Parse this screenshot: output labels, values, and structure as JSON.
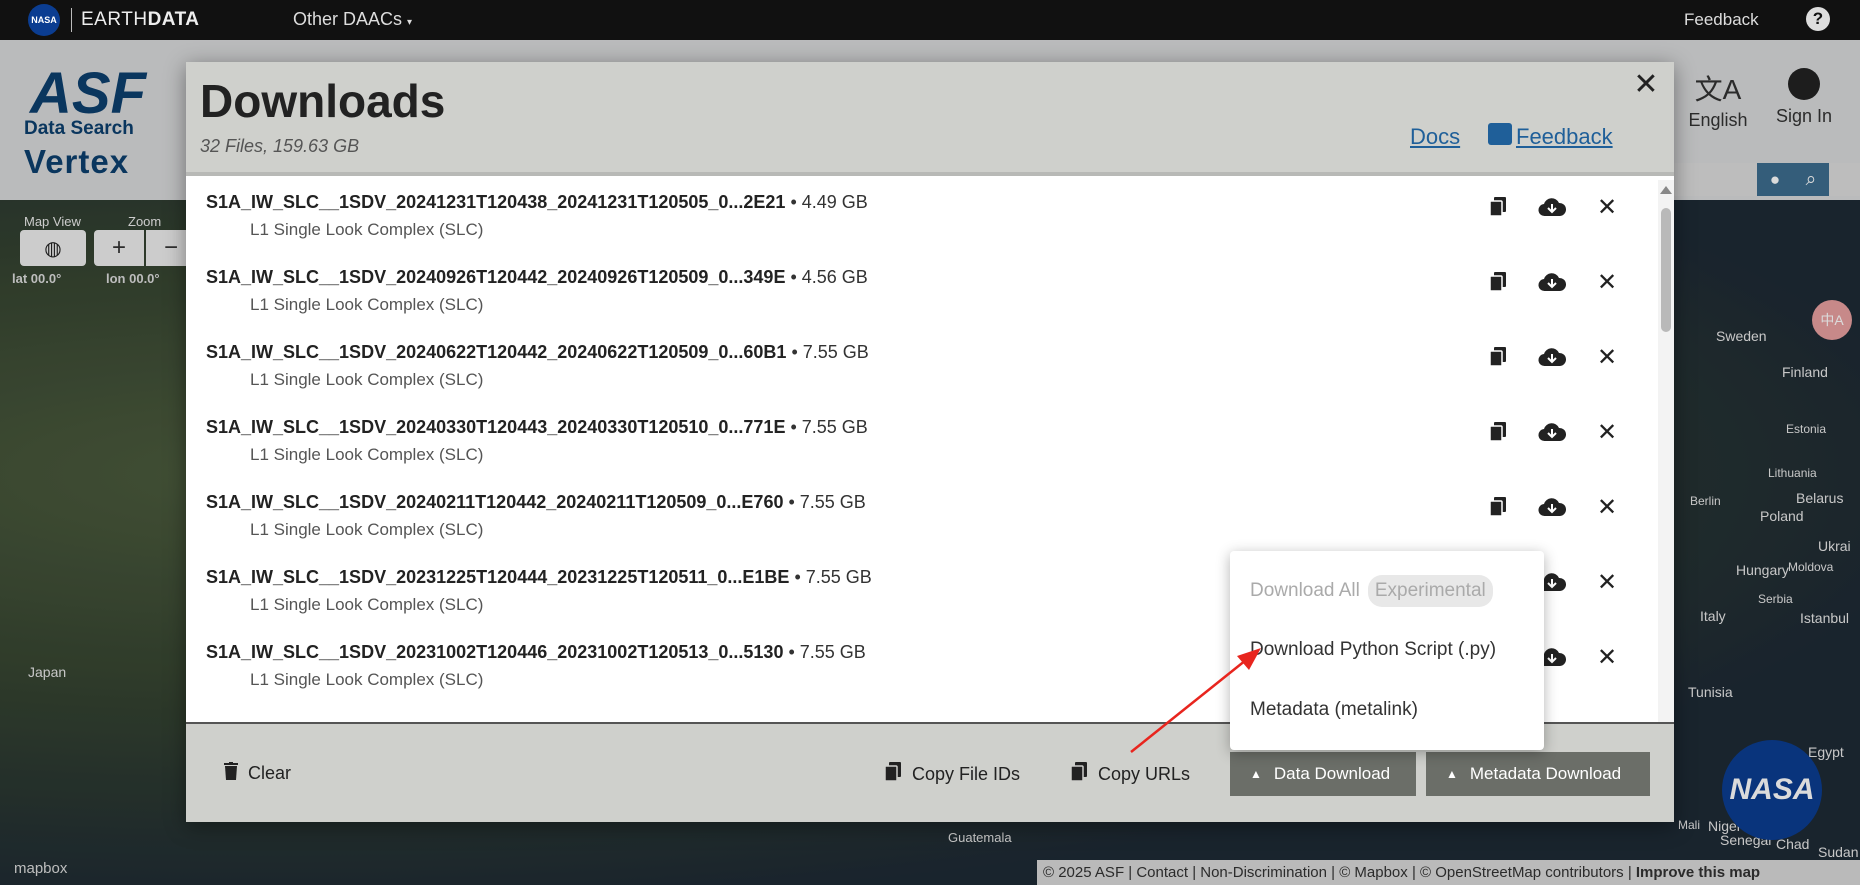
{
  "topbar": {
    "nasa": "NASA",
    "earth": "EARTH",
    "data": "DATA",
    "daacs": "Other DAACs",
    "feedback": "Feedback",
    "help": "?"
  },
  "app": {
    "logo_asf": "ASF",
    "logo_data_search": "Data Search",
    "logo_vertex": "Vertex",
    "language": "English",
    "sign_in": "Sign In"
  },
  "map": {
    "map_view_label": "Map View",
    "zoom_label": "Zoom",
    "lat": "lat 00.0°",
    "lon": "lon 00.0°",
    "places": [
      "Japan",
      "Sweden",
      "Finland",
      "Estonia",
      "Lithuania",
      "Belarus",
      "Poland",
      "Berlin",
      "Ukrai",
      "Hungary",
      "Moldova",
      "Italy",
      "Serbia",
      "Istanbul",
      "Tunisia",
      "Senegal",
      "Niger",
      "Chad",
      "Sudan",
      "Mali",
      "Guatemala",
      "Egypt"
    ],
    "mapbox": "mapbox",
    "attribution": "© 2025 ASF  | Contact | Non-Discrimination | © Mapbox | © OpenStreetMap contributors | ",
    "improve": "Improve this map",
    "nasa_badge": "NASA"
  },
  "dialog": {
    "title": "Downloads",
    "subtitle": "32 Files, 159.63 GB",
    "docs": "Docs",
    "feedback": "Feedback",
    "files": [
      {
        "name": "S1A_IW_SLC__1SDV_20241231T120438_20241231T120505_0...2E21",
        "size": " • 4.49 GB",
        "type": "L1 Single Look Complex (SLC)"
      },
      {
        "name": "S1A_IW_SLC__1SDV_20240926T120442_20240926T120509_0...349E",
        "size": " • 4.56 GB",
        "type": "L1 Single Look Complex (SLC)"
      },
      {
        "name": "S1A_IW_SLC__1SDV_20240622T120442_20240622T120509_0...60B1",
        "size": " • 7.55 GB",
        "type": "L1 Single Look Complex (SLC)"
      },
      {
        "name": "S1A_IW_SLC__1SDV_20240330T120443_20240330T120510_0...771E",
        "size": " • 7.55 GB",
        "type": "L1 Single Look Complex (SLC)"
      },
      {
        "name": "S1A_IW_SLC__1SDV_20240211T120442_20240211T120509_0...E760",
        "size": " • 7.55 GB",
        "type": "L1 Single Look Complex (SLC)"
      },
      {
        "name": "S1A_IW_SLC__1SDV_20231225T120444_20231225T120511_0...E1BE",
        "size": " • 7.55 GB",
        "type": "L1 Single Look Complex (SLC)"
      },
      {
        "name": "S1A_IW_SLC__1SDV_20231002T120446_20231002T120513_0...5130",
        "size": " • 7.55 GB",
        "type": "L1 Single Look Complex (SLC)"
      }
    ],
    "footer": {
      "clear": "Clear",
      "copy_ids": "Copy File IDs",
      "copy_urls": "Copy URLs",
      "data_download": "Data Download",
      "metadata_download": "Metadata Download"
    },
    "menu": {
      "download_all": "Download All",
      "experimental": "Experimental",
      "python_script": "Download Python Script (.py)",
      "metalink": "Metadata (metalink)"
    }
  },
  "icons": {
    "copy": "copy-icon",
    "download": "cloud-download-icon",
    "remove": "close-icon",
    "trash": "trash-icon"
  },
  "colors": {
    "link": "#1f5f99",
    "dialog_header": "#cfd0cc",
    "dark_button": "#6b6e68",
    "annotation": "#e8251e"
  }
}
